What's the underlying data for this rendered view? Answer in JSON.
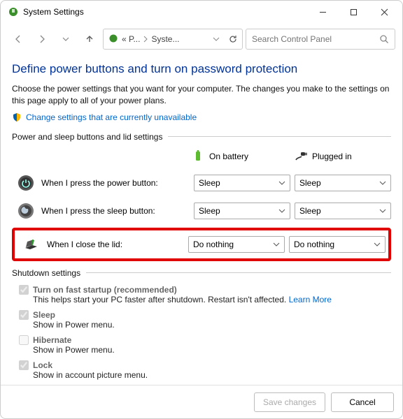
{
  "window": {
    "title": "System Settings"
  },
  "nav": {
    "crumb1": "« P...",
    "crumb2": "Syste...",
    "search_placeholder": "Search Control Panel"
  },
  "page": {
    "title": "Define power buttons and turn on password protection",
    "description": "Choose the power settings that you want for your computer. The changes you make to the settings on this page apply to all of your power plans.",
    "change_link": "Change settings that are currently unavailable"
  },
  "group": {
    "power_title": "Power and sleep buttons and lid settings",
    "col_battery": "On battery",
    "col_plugged": "Plugged in",
    "rows": [
      {
        "label": "When I press the power button:",
        "batt": "Sleep",
        "plug": "Sleep"
      },
      {
        "label": "When I press the sleep button:",
        "batt": "Sleep",
        "plug": "Sleep"
      },
      {
        "label": "When I close the lid:",
        "batt": "Do nothing",
        "plug": "Do nothing"
      }
    ],
    "shutdown_title": "Shutdown settings",
    "shutdown": {
      "fast_label": "Turn on fast startup (recommended)",
      "fast_desc": "This helps start your PC faster after shutdown. Restart isn't affected. ",
      "fast_link": "Learn More",
      "sleep_label": "Sleep",
      "sleep_desc": "Show in Power menu.",
      "hibernate_label": "Hibernate",
      "hibernate_desc": "Show in Power menu.",
      "lock_label": "Lock",
      "lock_desc": "Show in account picture menu."
    }
  },
  "footer": {
    "save": "Save changes",
    "cancel": "Cancel"
  }
}
